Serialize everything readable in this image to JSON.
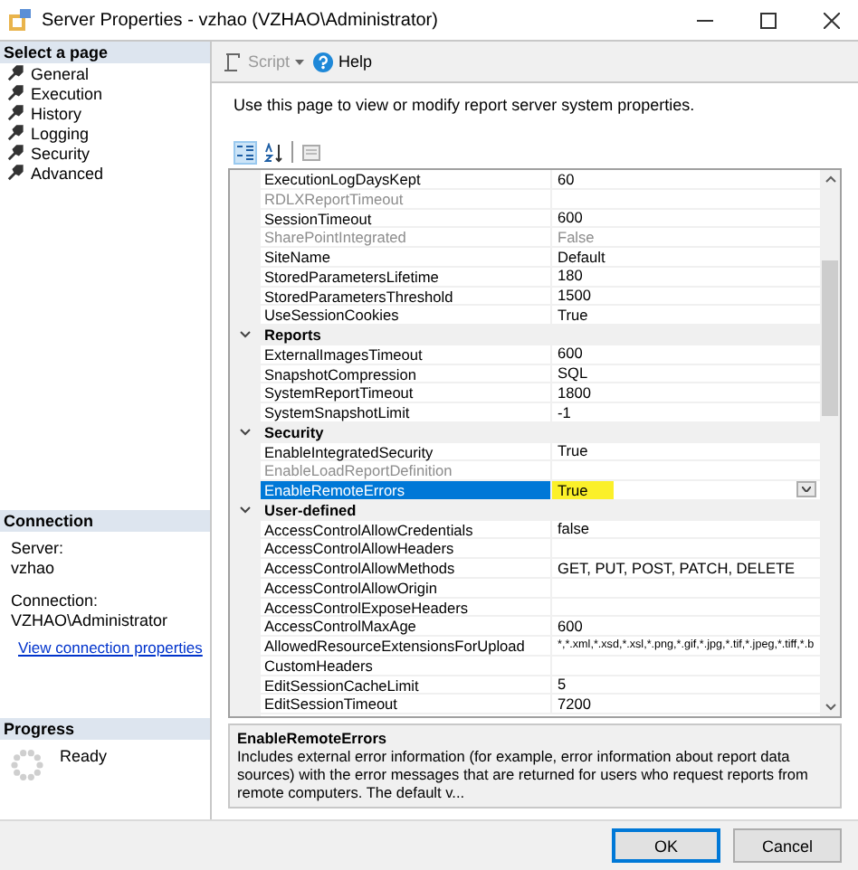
{
  "window": {
    "title": "Server Properties - vzhao (VZHAO\\Administrator)"
  },
  "sidebar": {
    "header": "Select a page",
    "pages": [
      {
        "label": "General"
      },
      {
        "label": "Execution"
      },
      {
        "label": "History"
      },
      {
        "label": "Logging"
      },
      {
        "label": "Security"
      },
      {
        "label": "Advanced"
      }
    ]
  },
  "connection": {
    "header": "Connection",
    "server_label": "Server:",
    "server": "vzhao",
    "connection_label": "Connection:",
    "connection": "VZHAO\\Administrator",
    "link": "View connection properties"
  },
  "progress": {
    "header": "Progress",
    "status": "Ready"
  },
  "toolbar": {
    "script": "Script",
    "help": "Help"
  },
  "description": "Use this page to view or modify report server system properties.",
  "grid": {
    "rows": [
      {
        "kind": "property",
        "name": "ExecutionLogDaysKept",
        "value": "60",
        "disabled": false,
        "selected": false
      },
      {
        "kind": "property",
        "name": "RDLXReportTimeout",
        "disabled": true,
        "selected": false
      },
      {
        "kind": "property",
        "name": "SessionTimeout",
        "value": "600",
        "disabled": false,
        "selected": false
      },
      {
        "kind": "property",
        "name": "SharePointIntegrated",
        "value": "False",
        "disabled": true,
        "selected": false
      },
      {
        "kind": "property",
        "name": "SiteName",
        "value": "Default",
        "disabled": false,
        "selected": false
      },
      {
        "kind": "property",
        "name": "StoredParametersLifetime",
        "value": "180",
        "disabled": false,
        "selected": false
      },
      {
        "kind": "property",
        "name": "StoredParametersThreshold",
        "value": "1500",
        "disabled": false,
        "selected": false
      },
      {
        "kind": "property",
        "name": "UseSessionCookies",
        "value": "True",
        "disabled": false,
        "selected": false
      },
      {
        "kind": "category",
        "name": "Reports",
        "expanded": true
      },
      {
        "kind": "property",
        "name": "ExternalImagesTimeout",
        "value": "600",
        "disabled": false,
        "selected": false
      },
      {
        "kind": "property",
        "name": "SnapshotCompression",
        "value": "SQL",
        "disabled": false,
        "selected": false
      },
      {
        "kind": "property",
        "name": "SystemReportTimeout",
        "value": "1800",
        "disabled": false,
        "selected": false
      },
      {
        "kind": "property",
        "name": "SystemSnapshotLimit",
        "value": "-1",
        "disabled": false,
        "selected": false
      },
      {
        "kind": "category",
        "name": "Security",
        "expanded": true
      },
      {
        "kind": "property",
        "name": "EnableIntegratedSecurity",
        "value": "True",
        "disabled": false,
        "selected": false
      },
      {
        "kind": "property",
        "name": "EnableLoadReportDefinition",
        "disabled": true,
        "selected": false
      },
      {
        "kind": "property",
        "name": "EnableRemoteErrors",
        "value": "True",
        "disabled": false,
        "selected": true,
        "highlighted": true
      },
      {
        "kind": "category",
        "name": "User-defined",
        "expanded": true
      },
      {
        "kind": "property",
        "name": "AccessControlAllowCredentials",
        "value": "false",
        "disabled": false,
        "selected": false
      },
      {
        "kind": "property",
        "name": "AccessControlAllowHeaders",
        "disabled": false,
        "selected": false
      },
      {
        "kind": "property",
        "name": "AccessControlAllowMethods",
        "value": "GET, PUT, POST, PATCH, DELETE",
        "disabled": false,
        "selected": false
      },
      {
        "kind": "property",
        "name": "AccessControlAllowOrigin",
        "disabled": false,
        "selected": false
      },
      {
        "kind": "property",
        "name": "AccessControlExposeHeaders",
        "disabled": false,
        "selected": false
      },
      {
        "kind": "property",
        "name": "AccessControlMaxAge",
        "value": "600",
        "disabled": false,
        "selected": false
      },
      {
        "kind": "property",
        "name": "AllowedResourceExtensionsForUpload",
        "value": "*,*.xml,*.xsd,*.xsl,*.png,*.gif,*.jpg,*.tif,*.jpeg,*.tiff,*.b",
        "disabled": false,
        "selected": false
      },
      {
        "kind": "property",
        "name": "CustomHeaders",
        "disabled": false,
        "selected": false
      },
      {
        "kind": "property",
        "name": "EditSessionCacheLimit",
        "value": "5",
        "disabled": false,
        "selected": false
      },
      {
        "kind": "property",
        "name": "EditSessionTimeout",
        "value": "7200",
        "disabled": false,
        "selected": false
      }
    ]
  },
  "help_box": {
    "title": "EnableRemoteErrors",
    "text": "Includes external error information (for example, error information about report data sources) with the error messages that are returned for users who request reports from remote computers. The default v..."
  },
  "buttons": [
    {
      "label": "OK",
      "kind": "default"
    },
    {
      "label": "Cancel",
      "kind": "normal"
    }
  ]
}
